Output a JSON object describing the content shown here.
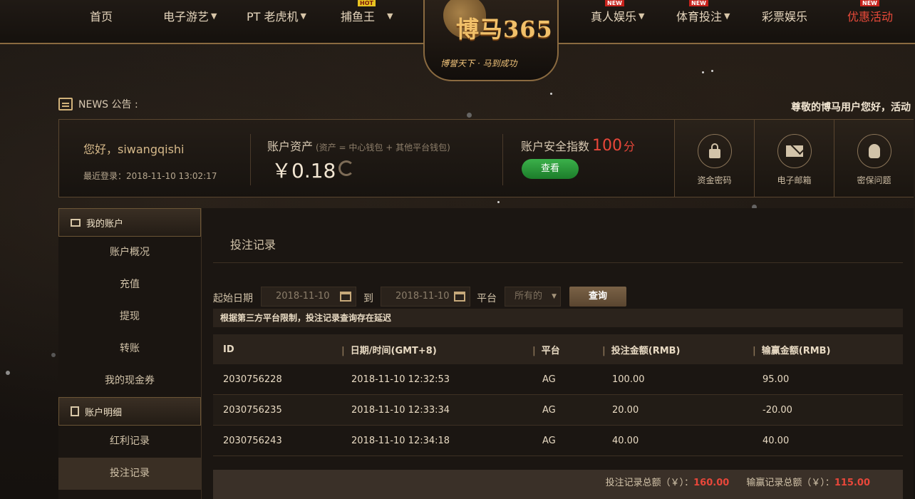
{
  "nav": {
    "items": [
      {
        "label": "首页"
      },
      {
        "label": "电子游艺"
      },
      {
        "label": "PT 老虎机"
      },
      {
        "label": "捕鱼王"
      },
      {
        "label": "真人娱乐"
      },
      {
        "label": "体育投注"
      },
      {
        "label": "彩票娱乐"
      },
      {
        "label": "优惠活动"
      }
    ],
    "badge_new": "NEW",
    "badge_hot": "HOT"
  },
  "logo": {
    "main": "博马365",
    "slogan": "博誉天下 · 马到成功"
  },
  "news": {
    "label": "NEWS 公告 :",
    "scroll_text": "尊敬的博马用户您好，活动"
  },
  "account": {
    "greeting": "您好，siwangqishi",
    "last_login": "最近登录：2018-11-10 13:02:17",
    "assets_label": "账户资产",
    "assets_note": "(资产 = 中心钱包 + 其他平台钱包)",
    "assets_value": "￥0.18",
    "security_label": "账户安全指数",
    "security_score": "100",
    "security_unit": "分",
    "view_button": "查看",
    "tiles": [
      {
        "label": "资金密码",
        "icon": "lock-icon"
      },
      {
        "label": "电子邮箱",
        "icon": "mail-icon"
      },
      {
        "label": "密保问题",
        "icon": "lightbulb-icon"
      }
    ]
  },
  "sidebar": {
    "section1_title": "我的账户",
    "section1_items": [
      "账户概况",
      "充值",
      "提现",
      "转账",
      "我的现金券"
    ],
    "section2_title": "账户明细",
    "section2_items": [
      "红利记录",
      "投注记录"
    ]
  },
  "main": {
    "title": "投注记录",
    "filter": {
      "start_label": "起始日期",
      "start_value": "2018-11-10",
      "to_label": "到",
      "end_value": "2018-11-10",
      "platform_label": "平台",
      "platform_value": "所有的",
      "query_button": "查询"
    },
    "notice": "根据第三方平台限制，投注记录查询存在延迟",
    "table": {
      "headers": [
        "ID",
        "日期/时间(GMT+8)",
        "平台",
        "投注金额(RMB)",
        "输赢金额(RMB)"
      ],
      "rows": [
        [
          "2030756228",
          "2018-11-10 12:32:53",
          "AG",
          "100.00",
          "95.00"
        ],
        [
          "2030756235",
          "2018-11-10 12:33:34",
          "AG",
          "20.00",
          "-20.00"
        ],
        [
          "2030756243",
          "2018-11-10 12:34:18",
          "AG",
          "40.00",
          "40.00"
        ]
      ]
    },
    "summary": {
      "bet_total_label": "投注记录总额（￥）：",
      "bet_total_value": "160.00",
      "win_total_label": "输赢记录总额（￥）：",
      "win_total_value": "115.00"
    }
  },
  "colors": {
    "accent_gold": "#c7a97a",
    "promo_red": "#e94a3a",
    "button_green": "#2a9a3a",
    "background": "#1a1512"
  }
}
